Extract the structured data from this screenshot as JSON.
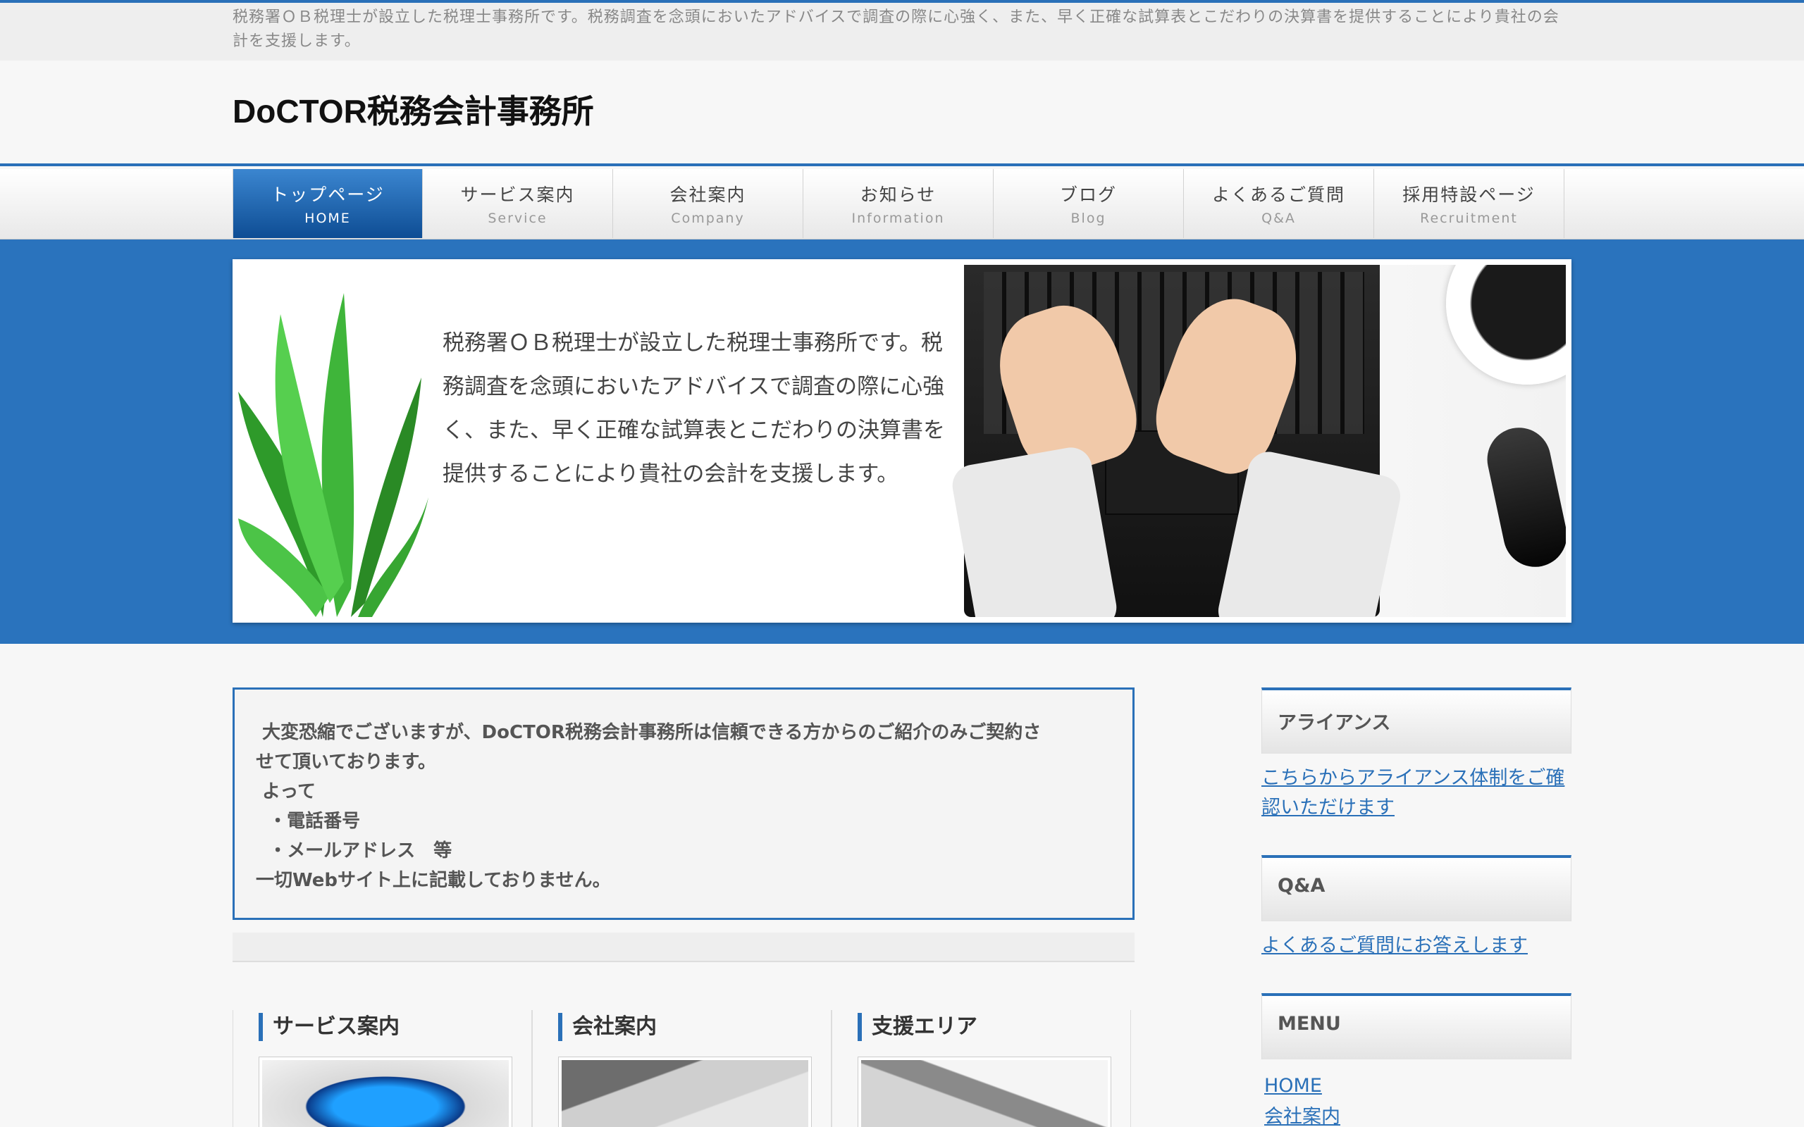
{
  "header": {
    "description": "税務署ＯＢ税理士が設立した税理士事務所です。税務調査を念頭においたアドバイスで調査の際に心強く、また、早く正確な試算表とこだわりの決算書を提供することにより貴社の会計を支援します。",
    "site_title": "DoCTOR税務会計事務所"
  },
  "nav": [
    {
      "jp": "トップページ",
      "en": "HOME"
    },
    {
      "jp": "サービス案内",
      "en": "Service"
    },
    {
      "jp": "会社案内",
      "en": "Company"
    },
    {
      "jp": "お知らせ",
      "en": "Information"
    },
    {
      "jp": "ブログ",
      "en": "Blog"
    },
    {
      "jp": "よくあるご質問",
      "en": "Q&A"
    },
    {
      "jp": "採用特設ページ",
      "en": "Recruitment"
    }
  ],
  "hero": {
    "text": "税務署ＯＢ税理士が設立した税理士事務所です。税務調査を念頭においたアドバイスで調査の際に心強く、また、早く正確な試算表とこだわりの決算書を提供することにより貴社の会計を支援します。"
  },
  "notice": {
    "text": " 大変恐縮でございますが、DoCTOR税務会計事務所は信頼できる方からのご紹介のみご契約さ\nせて頂いております。\n よって\n  ・電話番号\n  ・メールアドレス　等\n一切Webサイト上に記載しておりません。"
  },
  "columns": [
    {
      "title": "サービス案内"
    },
    {
      "title": "会社案内"
    },
    {
      "title": "支援エリア"
    }
  ],
  "sidebar": {
    "alliance": {
      "heading": "アライアンス",
      "link": "こちらからアライアンス体制をご確認いただけます"
    },
    "qa": {
      "heading": "Q&A",
      "link": "よくあるご質問にお答えします"
    },
    "menu": {
      "heading": "MENU",
      "items": [
        "HOME",
        "会社案内"
      ]
    }
  },
  "colors": {
    "accent": "#2a70b8",
    "hero_band": "#2a73bd"
  }
}
